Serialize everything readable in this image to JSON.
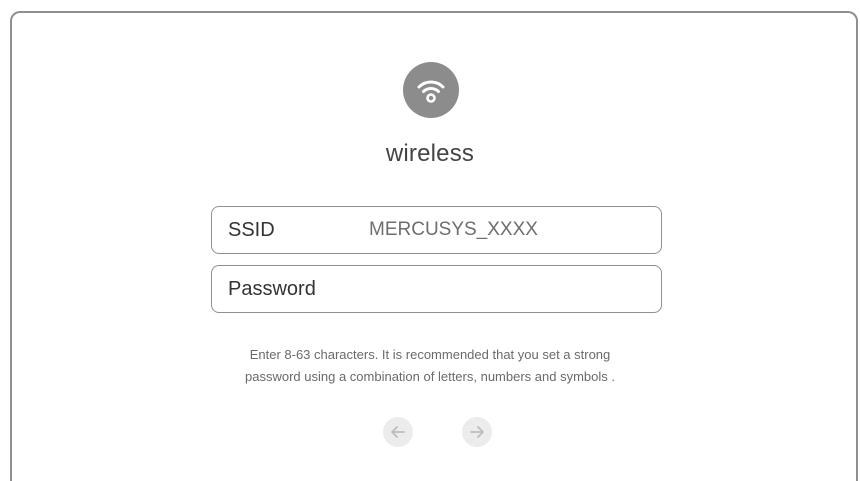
{
  "header": {
    "icon": "wifi-icon",
    "title": "wireless"
  },
  "form": {
    "ssid": {
      "label": "SSID",
      "value": "MERCUSYS_XXXX"
    },
    "password": {
      "label": "Password",
      "value": ""
    }
  },
  "hint": {
    "line1": "Enter 8-63 characters. It is recommended that you set a strong",
    "line2": "password using a combination of letters, numbers and symbols ."
  },
  "navigation": {
    "back_icon": "arrow-left-icon",
    "next_icon": "arrow-right-icon"
  },
  "colors": {
    "icon_badge": "#8c8c8c",
    "border": "#8f8f8f",
    "arrow": "#bdbdbd"
  }
}
